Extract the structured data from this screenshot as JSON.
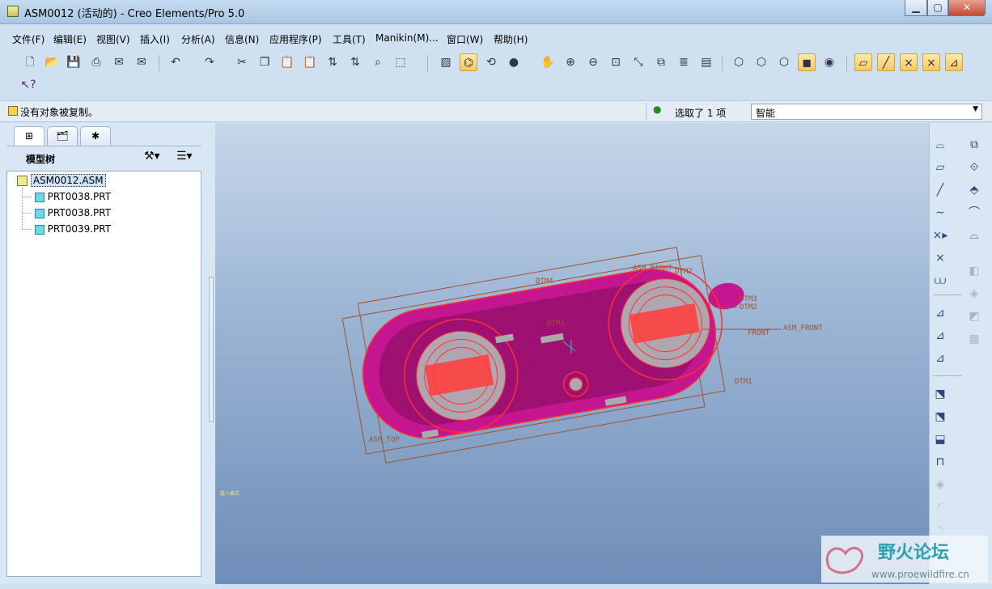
{
  "window": {
    "title": "ASM0012 (活动的) - Creo Elements/Pro 5.0"
  },
  "menu": [
    "文件(F)",
    "编辑(E)",
    "视图(V)",
    "插入(I)",
    "分析(A)",
    "信息(N)",
    "应用程序(P)",
    "工具(T)",
    "Manikin(M)...",
    "窗口(W)",
    "帮助(H)"
  ],
  "status": {
    "message": "没有对象被复制。",
    "selection": "选取了 1 项",
    "filter_value": "智能"
  },
  "model_tree": {
    "title": "模型树",
    "items": [
      "ASM0012.ASM",
      "PRT0038.PRT",
      "PRT0038.PRT",
      "PRT0039.PRT"
    ]
  },
  "viewport": {
    "labels": [
      "ASM_RIGHT",
      "DTM2",
      "DTM4",
      "DTM3",
      "DTM2",
      "ASM_FRONT",
      "DTM1",
      "DTM1",
      "ASM_TOP",
      "FRONT"
    ],
    "corner_note": "露入模式"
  },
  "watermark": {
    "logo_text": "野火论坛",
    "url": "www.proewildfire.cn"
  },
  "colors": {
    "accent": "#3a6fb0",
    "part_magenta": "#c3168f",
    "edge_red": "#ff3030",
    "datum_brown": "#a0522d",
    "viewport_top": "#c7d7ea",
    "viewport_bottom": "#6e8db8"
  }
}
